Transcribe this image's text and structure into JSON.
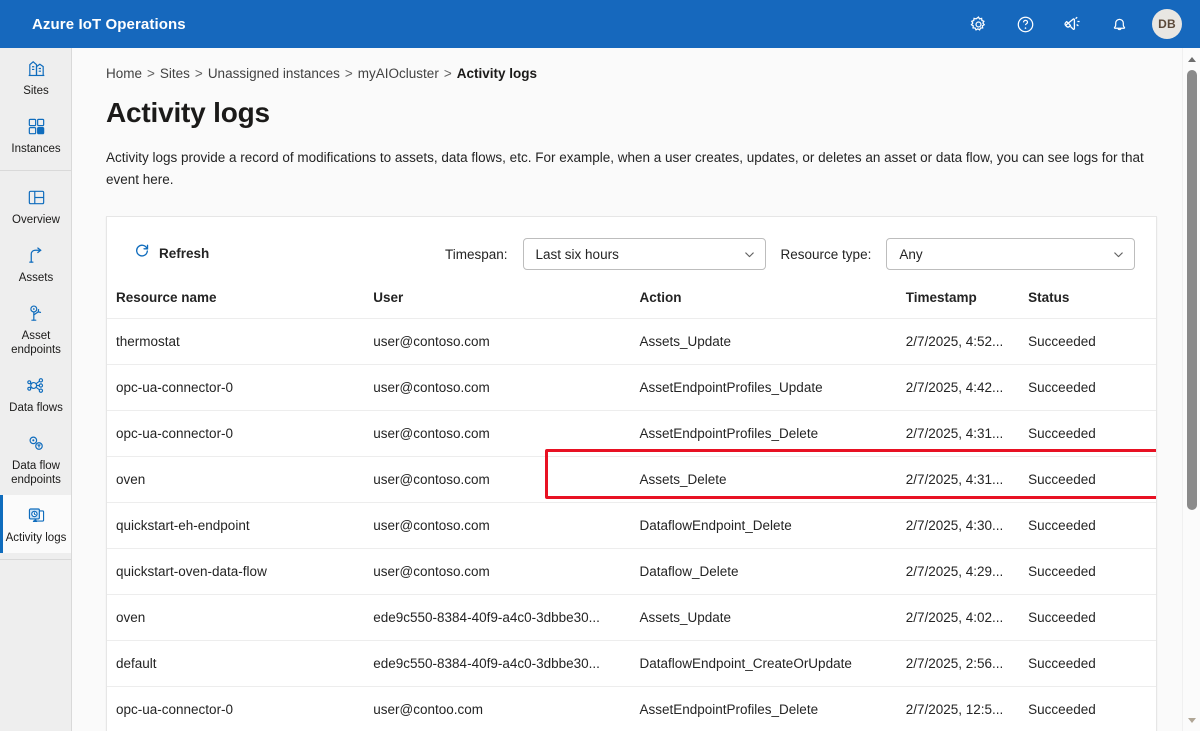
{
  "topbar": {
    "brand": "Azure IoT Operations",
    "icons": [
      {
        "name": "gear-icon",
        "label": "Settings"
      },
      {
        "name": "help-icon",
        "label": "Help"
      },
      {
        "name": "feedback-icon",
        "label": "Feedback"
      },
      {
        "name": "bell-icon",
        "label": "Notifications"
      }
    ],
    "avatar_initials": "DB",
    "background_color": "#1668bd"
  },
  "sidebar": {
    "groups": [
      {
        "items": [
          {
            "label": "Sites",
            "icon": "sites-icon",
            "active": false
          },
          {
            "label": "Instances",
            "icon": "instances-icon",
            "active": false
          }
        ]
      },
      {
        "items": [
          {
            "label": "Overview",
            "icon": "overview-icon",
            "active": false
          },
          {
            "label": "Assets",
            "icon": "assets-icon",
            "active": false
          },
          {
            "label": "Asset endpoints",
            "icon": "asset-endpoints-icon",
            "active": false
          },
          {
            "label": "Data flows",
            "icon": "data-flows-icon",
            "active": false
          },
          {
            "label": "Data flow endpoints",
            "icon": "data-flow-endpoints-icon",
            "active": false
          },
          {
            "label": "Activity logs",
            "icon": "activity-logs-icon",
            "active": true
          }
        ]
      }
    ],
    "active_accent_color": "#0f6cbd"
  },
  "breadcrumb": {
    "items": [
      "Home",
      "Sites",
      "Unassigned instances",
      "myAIOcluster",
      "Activity logs"
    ],
    "separator": ">"
  },
  "page": {
    "title": "Activity logs",
    "description": "Activity logs provide a record of modifications to assets, data flows, etc. For example, when a user creates, updates, or deletes an asset or data flow, you can see logs for that event here."
  },
  "toolbar": {
    "refresh_label": "Refresh",
    "refresh_icon": "refresh-icon",
    "timespan_label": "Timespan:",
    "timespan_value": "Last six hours",
    "resource_type_label": "Resource type:",
    "resource_type_value": "Any",
    "chevron_icon": "chevron-down-icon"
  },
  "annotation": {
    "highlight_color": "#e81123"
  },
  "table": {
    "columns": [
      "Resource name",
      "User",
      "Action",
      "Timestamp",
      "Status"
    ],
    "rows": [
      {
        "resource": "thermostat",
        "user": "user@contoso.com",
        "action": "Assets_Update",
        "timestamp": "2/7/2025, 4:52...",
        "status": "Succeeded"
      },
      {
        "resource": "opc-ua-connector-0",
        "user": "user@contoso.com",
        "action": "AssetEndpointProfiles_Update",
        "timestamp": "2/7/2025, 4:42...",
        "status": "Succeeded"
      },
      {
        "resource": "opc-ua-connector-0",
        "user": "user@contoso.com",
        "action": "AssetEndpointProfiles_Delete",
        "timestamp": "2/7/2025, 4:31...",
        "status": "Succeeded"
      },
      {
        "resource": "oven",
        "user": "user@contoso.com",
        "action": "Assets_Delete",
        "timestamp": "2/7/2025, 4:31...",
        "status": "Succeeded"
      },
      {
        "resource": "quickstart-eh-endpoint",
        "user": "user@contoso.com",
        "action": "DataflowEndpoint_Delete",
        "timestamp": "2/7/2025, 4:30...",
        "status": "Succeeded"
      },
      {
        "resource": "quickstart-oven-data-flow",
        "user": "user@contoso.com",
        "action": "Dataflow_Delete",
        "timestamp": "2/7/2025, 4:29...",
        "status": "Succeeded"
      },
      {
        "resource": "oven",
        "user": "ede9c550-8384-40f9-a4c0-3dbbe30...",
        "action": "Assets_Update",
        "timestamp": "2/7/2025, 4:02...",
        "status": "Succeeded"
      },
      {
        "resource": "default",
        "user": "ede9c550-8384-40f9-a4c0-3dbbe30...",
        "action": "DataflowEndpoint_CreateOrUpdate",
        "timestamp": "2/7/2025, 2:56...",
        "status": "Succeeded"
      },
      {
        "resource": "opc-ua-connector-0",
        "user": "user@contoo.com",
        "action": "AssetEndpointProfiles_Delete",
        "timestamp": "2/7/2025, 12:5...",
        "status": "Succeeded"
      }
    ]
  },
  "scrollbar": {
    "up_arrow": "scroll-up-arrow",
    "down_arrow": "scroll-down-arrow"
  }
}
